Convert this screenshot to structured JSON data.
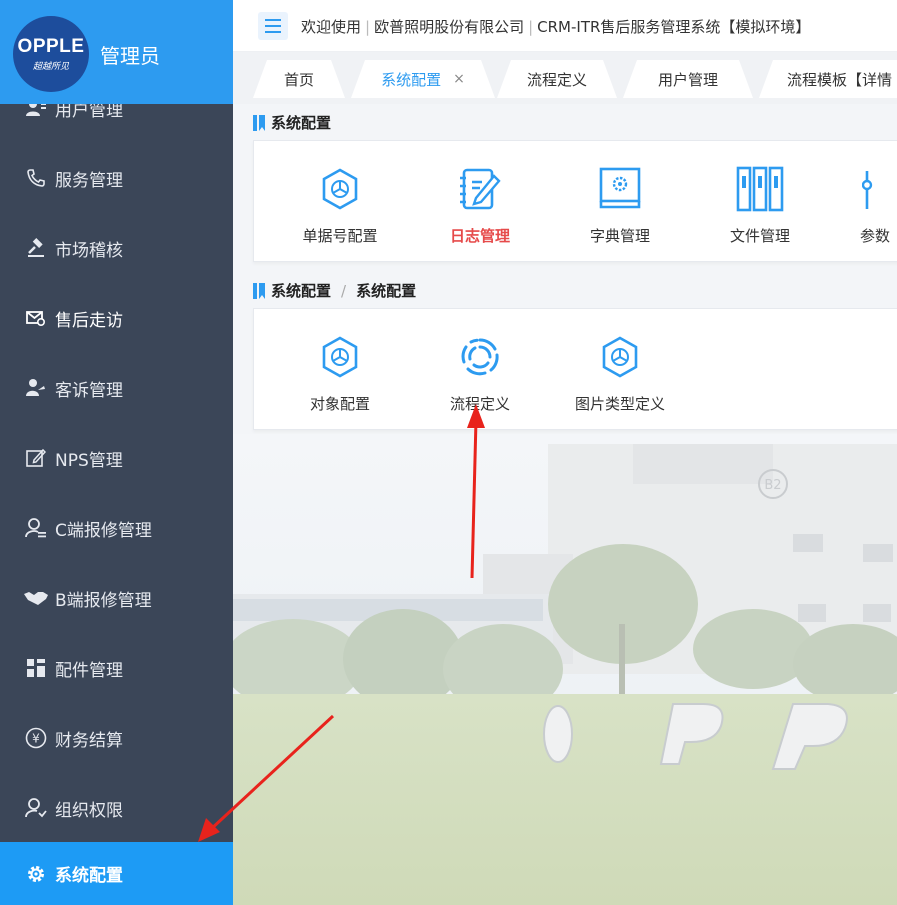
{
  "sidebar": {
    "logo_text": "OPPLE",
    "logo_subtext": "超越所见",
    "admin_name": "管理员",
    "items": [
      {
        "label": "用户管理",
        "icon": "users-icon"
      },
      {
        "label": "服务管理",
        "icon": "phone-icon"
      },
      {
        "label": "市场稽核",
        "icon": "gavel-icon"
      },
      {
        "label": "售后走访",
        "icon": "visit-icon"
      },
      {
        "label": "客诉管理",
        "icon": "complaint-icon"
      },
      {
        "label": "NPS管理",
        "icon": "edit-icon"
      },
      {
        "label": "C端报修管理",
        "icon": "user-repair-icon"
      },
      {
        "label": "B端报修管理",
        "icon": "handshake-icon"
      },
      {
        "label": "配件管理",
        "icon": "grid-icon"
      },
      {
        "label": "财务结算",
        "icon": "yen-icon"
      },
      {
        "label": "组织权限",
        "icon": "user-org-icon"
      },
      {
        "label": "系统配置",
        "icon": "gear-icon",
        "active": true
      }
    ]
  },
  "header": {
    "welcome": "欢迎使用",
    "company": "欧普照明股份有限公司",
    "system": "CRM-ITR售后服务管理系统【模拟环境】"
  },
  "tabs": [
    {
      "label": "首页"
    },
    {
      "label": "系统配置",
      "active": true,
      "close": "×"
    },
    {
      "label": "流程定义"
    },
    {
      "label": "用户管理"
    },
    {
      "label": "流程模板【详情"
    }
  ],
  "section1": {
    "title": "系统配置",
    "tiles": [
      {
        "label": "单据号配置",
        "icon": "hexagon-icon"
      },
      {
        "label": "日志管理",
        "icon": "notebook-pen-icon",
        "highlight": true
      },
      {
        "label": "字典管理",
        "icon": "dictionary-icon"
      },
      {
        "label": "文件管理",
        "icon": "files-icon"
      },
      {
        "label": "参数",
        "icon": "sliders-icon"
      }
    ]
  },
  "section2": {
    "title_part1": "系统配置",
    "title_sep": "/",
    "title_part2": "系统配置",
    "tiles": [
      {
        "label": "对象配置",
        "icon": "hexagon-icon"
      },
      {
        "label": "流程定义",
        "icon": "aperture-icon"
      },
      {
        "label": "图片类型定义",
        "icon": "hexagon-icon"
      }
    ]
  },
  "colors": {
    "sidebar_bg": "#3b4658",
    "accent": "#1d9bf5",
    "highlight": "#e64a4a",
    "arrow": "#e8231c"
  }
}
